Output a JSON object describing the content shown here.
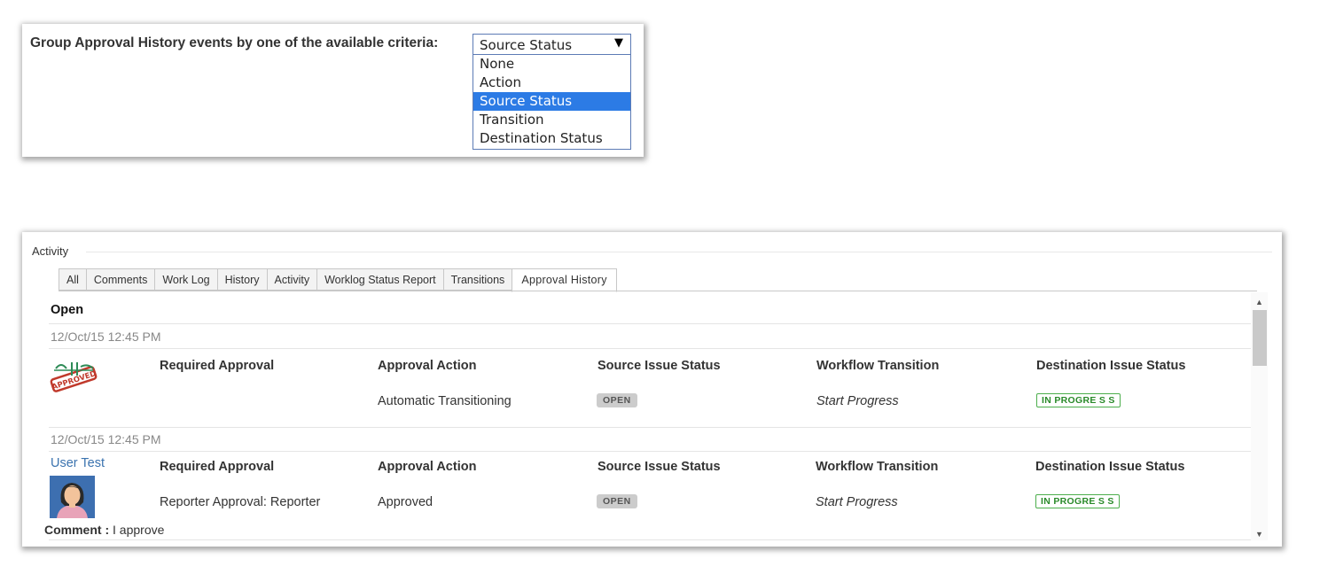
{
  "group_panel": {
    "label": "Group Approval History events by one of the available criteria:",
    "select_value": "Source Status",
    "select_arrow": "▼",
    "options": [
      "None",
      "Action",
      "Source Status",
      "Transition",
      "Destination Status"
    ],
    "selected_index": 2
  },
  "activity": {
    "title": "Activity",
    "tabs": [
      "All",
      "Comments",
      "Work Log",
      "History",
      "Activity",
      "Worklog Status Report",
      "Transitions",
      "Approval History"
    ],
    "active_tab": "Approval History",
    "section_title": "Open",
    "headers": {
      "required_approval": "Required Approval",
      "approval_action": "Approval Action",
      "source_status": "Source Issue Status",
      "workflow_transition": "Workflow Transition",
      "destination_status": "Destination Issue Status"
    },
    "entries": [
      {
        "date": "12/Oct/15 12:45 PM",
        "required_approval": "",
        "approval_action": "Automatic Transitioning",
        "source_status": "OPEN",
        "workflow_transition": "Start Progress",
        "destination_status": "IN PROGRE S S",
        "stamp_text": "APPROVED"
      },
      {
        "date": "12/Oct/15 12:45 PM",
        "user": "User Test",
        "required_approval": "Reporter Approval: Reporter",
        "approval_action": "Approved",
        "source_status": "OPEN",
        "workflow_transition": "Start Progress",
        "destination_status": "IN PROGRE S S",
        "comment_label": "Comment :",
        "comment_text": " I approve"
      }
    ]
  },
  "colors": {
    "selected_option_bg": "#2c7be5",
    "link": "#3b73af",
    "green_lozenge": "#4cae4c",
    "grey_lozenge": "#cccccc",
    "stamp_red": "#c0392b"
  }
}
